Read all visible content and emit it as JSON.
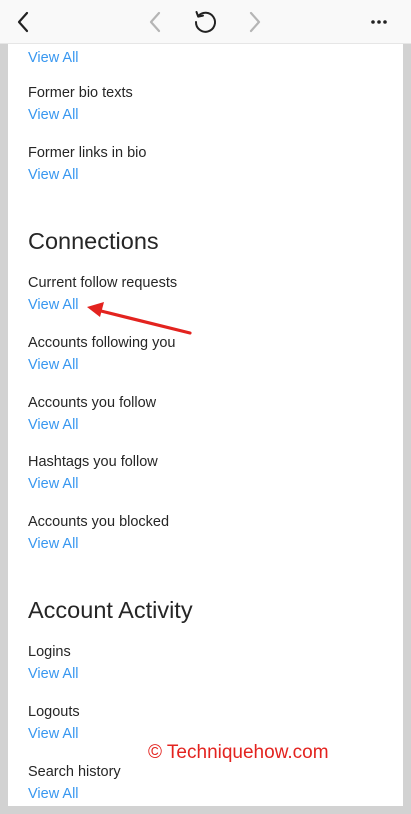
{
  "toolbar": {
    "back_icon": "chevron-left-icon",
    "prev_icon": "chevron-left-icon",
    "reload_icon": "reload-icon",
    "next_icon": "chevron-right-icon",
    "more_icon": "more-horizontal-icon"
  },
  "top_link": "View All",
  "profile_items": [
    {
      "label": "Former bio texts",
      "link": "View All"
    },
    {
      "label": "Former links in bio",
      "link": "View All"
    }
  ],
  "connections": {
    "heading": "Connections",
    "items": [
      {
        "label": "Current follow requests",
        "link": "View All"
      },
      {
        "label": "Accounts following you",
        "link": "View All"
      },
      {
        "label": "Accounts you follow",
        "link": "View All"
      },
      {
        "label": "Hashtags you follow",
        "link": "View All"
      },
      {
        "label": "Accounts you blocked",
        "link": "View All"
      }
    ]
  },
  "account_activity": {
    "heading": "Account Activity",
    "items": [
      {
        "label": "Logins",
        "link": "View All"
      },
      {
        "label": "Logouts",
        "link": "View All"
      },
      {
        "label": "Search history",
        "link": "View All"
      }
    ]
  },
  "annotation": {
    "arrow_color": "#e3231f"
  },
  "watermark": "© Techniquehow.com",
  "colors": {
    "link": "#3897f0",
    "text": "#262626",
    "toolbar_bg": "#f9f9f9",
    "page_bg": "#d2d2d2"
  }
}
